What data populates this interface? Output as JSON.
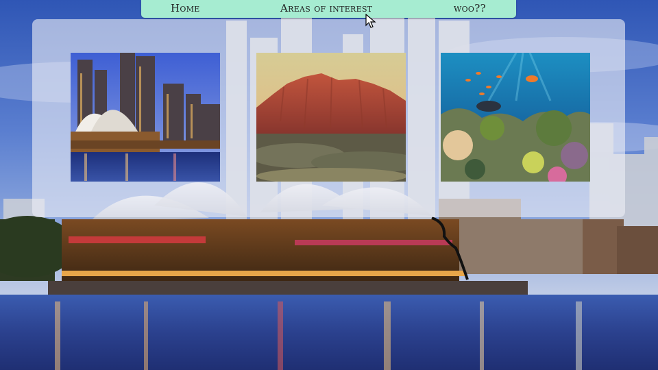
{
  "nav": {
    "items": [
      {
        "label": "Home"
      },
      {
        "label": "Areas of interest"
      },
      {
        "label": "woo??"
      }
    ]
  },
  "gallery": {
    "cards": [
      {
        "image": "sydney-opera-house-skyline-photo"
      },
      {
        "image": "red-mountain-range-outback-photo"
      },
      {
        "image": "coral-reef-tropical-fish-photo"
      }
    ]
  },
  "background": {
    "image": "sydney-harbour-opera-house-night-photo"
  },
  "colors": {
    "nav_bg": "#a6ecd1",
    "panel_bg": "rgba(236,238,245,0.62)",
    "sky": "#3d63b8",
    "water": "#2a3f8a"
  }
}
